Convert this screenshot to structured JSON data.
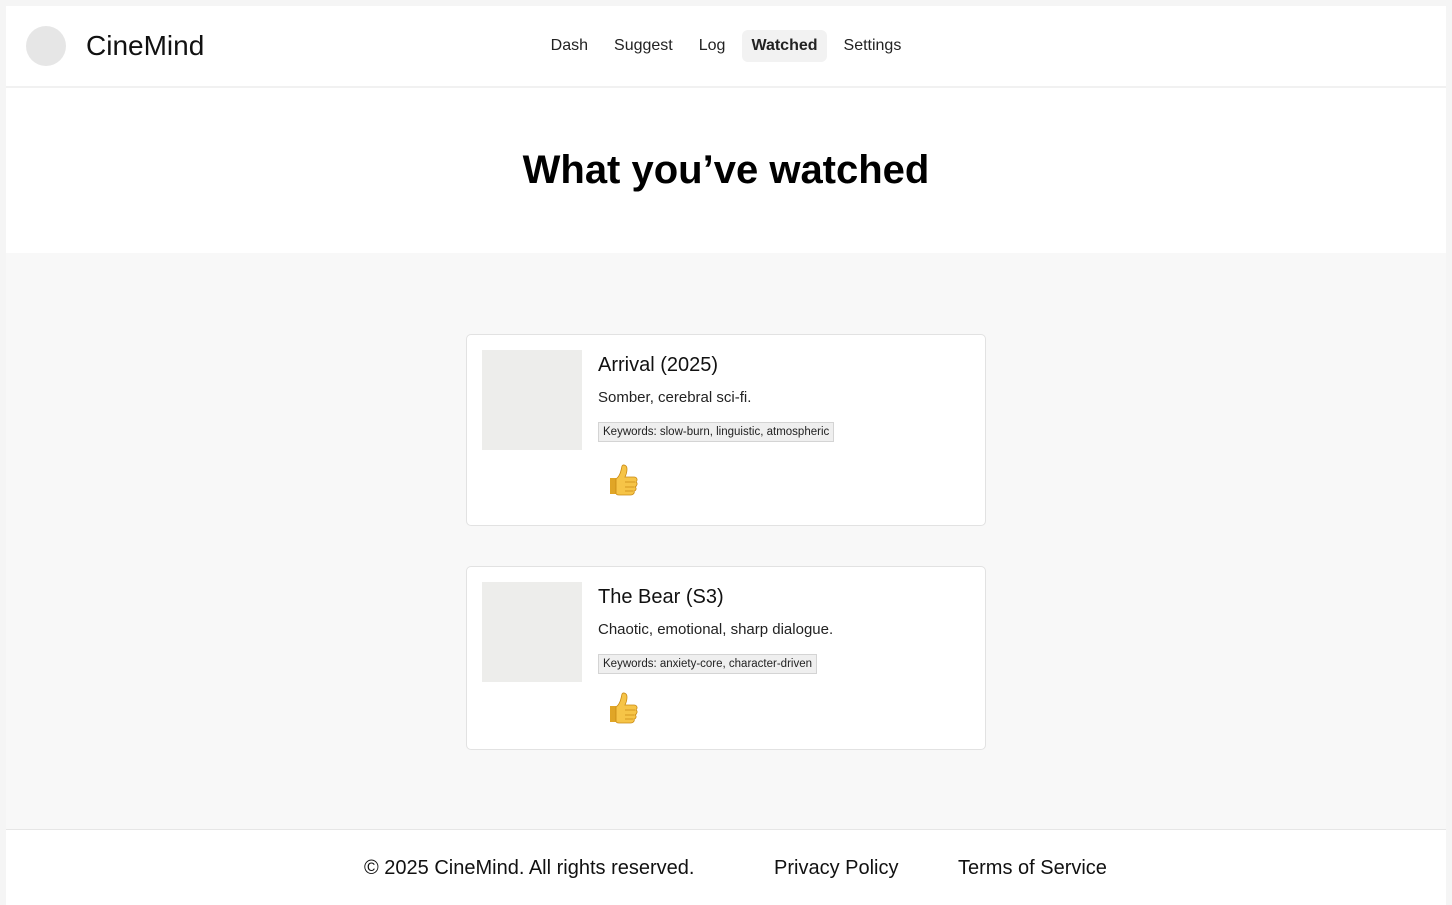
{
  "app": {
    "name": "CineMind"
  },
  "nav": {
    "items": [
      {
        "label": "Dash"
      },
      {
        "label": "Suggest"
      },
      {
        "label": "Log"
      },
      {
        "label": "Watched",
        "active": true
      },
      {
        "label": "Settings"
      }
    ]
  },
  "hero": {
    "title": "What you’ve watched"
  },
  "cards": [
    {
      "title": "Arrival (2025)",
      "description": "Somber, cerebral sci-fi.",
      "keywords": "Keywords: slow-burn, linguistic, atmospheric",
      "rating_icon": "thumbs-up-icon"
    },
    {
      "title": "The Bear (S3)",
      "description": "Chaotic, emotional, sharp dialogue.",
      "keywords": "Keywords: anxiety-core, character-driven",
      "rating_icon": "thumbs-up-icon"
    }
  ],
  "footer": {
    "copyright": "© 2025 CineMind. All rights reserved.",
    "privacy": "Privacy Policy",
    "terms": "Terms of Service"
  },
  "colors": {
    "thumb": "#f5c242",
    "thumb_dark": "#d89a1f"
  }
}
